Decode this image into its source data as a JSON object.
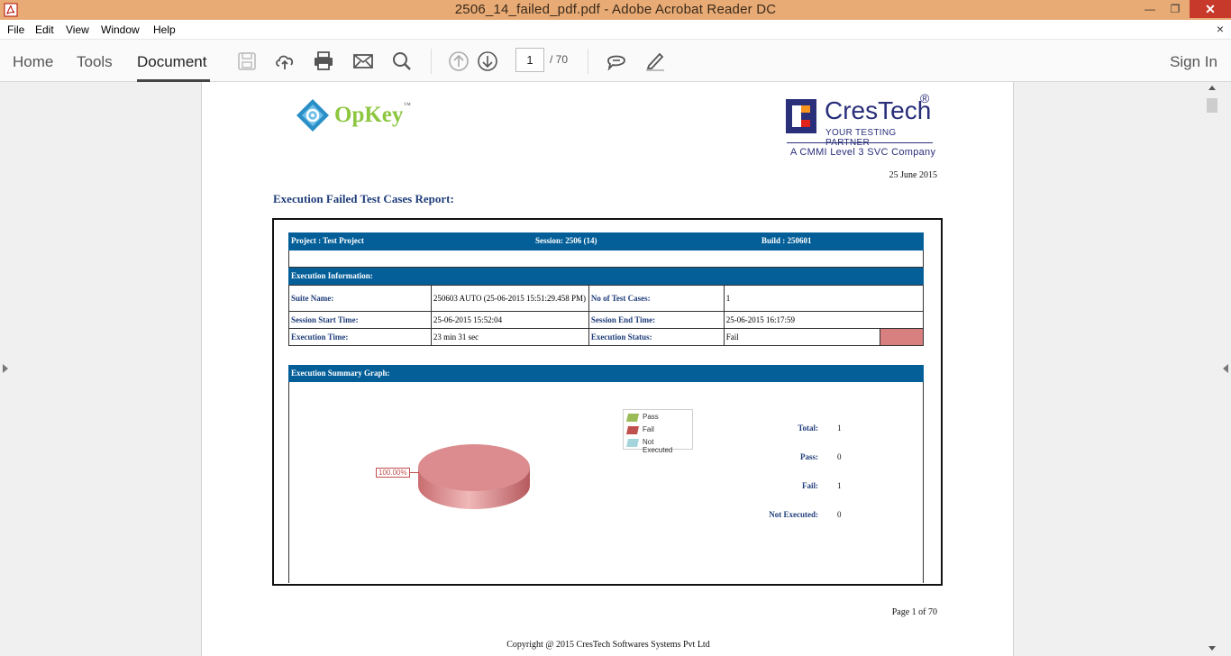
{
  "window": {
    "title": "2506_14_failed_pdf.pdf - Adobe Acrobat Reader DC"
  },
  "menu": {
    "items": [
      "File",
      "Edit",
      "View",
      "Window",
      "Help"
    ],
    "close": "×"
  },
  "toolbar": {
    "tabs": [
      "Home",
      "Tools",
      "Document"
    ],
    "active_tab": "Document",
    "page_current": "1",
    "page_total": "/ 70",
    "sign_in": "Sign In"
  },
  "document": {
    "opkey_logo": "OpKey",
    "opkey_tm": "™",
    "crestech_name": "CresTech",
    "crestech_reg": "®",
    "crestech_tag": "YOUR TESTING PARTNER",
    "crestech_cmmi": "A CMMI Level 3 SVC Company",
    "date": "25 June 2015",
    "report_title": "Execution Failed Test Cases Report:",
    "header": {
      "project": "Project :  Test Project",
      "session": "Session:     2506 (14)",
      "build": "Build :  250601"
    },
    "exec_info_title": "Execution Information:",
    "info_rows": [
      {
        "l1": "Suite Name:",
        "v1": "250603 AUTO (25-06-2015 15:51:29.458 PM)",
        "l2": "No of  Test Cases:",
        "v2": "1"
      },
      {
        "l1": "Session Start Time:",
        "v1": "25-06-2015 15:52:04",
        "l2": "Session End Time:",
        "v2": "25-06-2015 16:17:59"
      },
      {
        "l1": "Execution Time:",
        "v1": "23 min 31 sec",
        "l2": "Execution Status:",
        "v2": "Fail"
      }
    ],
    "status_color": "#d88080",
    "summary_title": "Execution  Summary Graph:",
    "chart_data": {
      "type": "pie",
      "categories": [
        "Pass",
        "Fail",
        "Not Executed"
      ],
      "values": [
        0,
        1,
        0
      ],
      "colors": [
        "#9bbb59",
        "#c0504d",
        "#a5d5dc"
      ],
      "slice_label": "100.00%"
    },
    "stats": [
      {
        "label": "Total:",
        "value": "1"
      },
      {
        "label": "Pass:",
        "value": "0"
      },
      {
        "label": "Fail:",
        "value": "1"
      },
      {
        "label": "Not Executed:",
        "value": "0"
      }
    ],
    "page_footer": "Page 1 of 70",
    "copyright": "Copyright @ 2015 CresTech Softwares Systems Pvt Ltd"
  },
  "colors": {
    "titlebar": "#e8ab76",
    "header_blue": "#045f99",
    "label_blue": "#1f3d7a"
  }
}
